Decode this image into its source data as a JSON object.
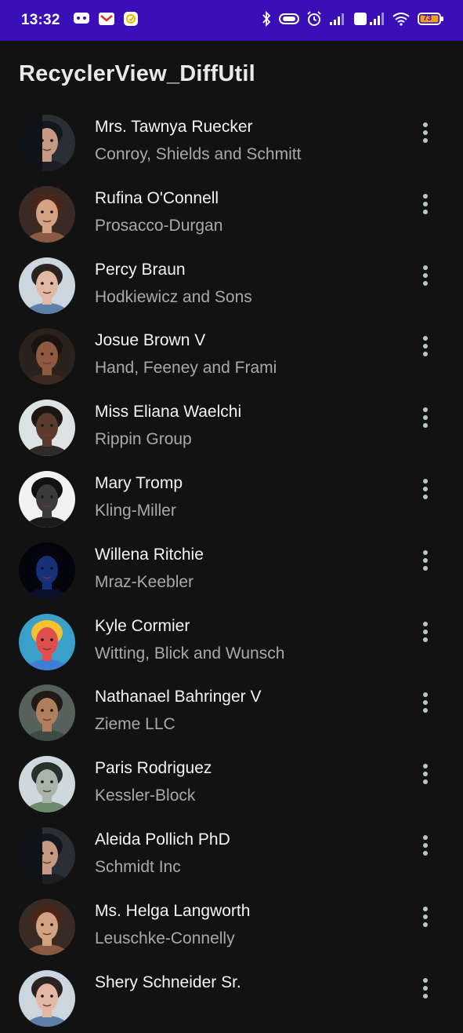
{
  "status_bar": {
    "time": "13:32",
    "battery": "73",
    "background": "#3b0fb8",
    "left_icons": [
      "chat-app-icon",
      "gmail-icon",
      "sync-app-icon"
    ],
    "right_icons": [
      "bluetooth-icon",
      "toggle-icon",
      "alarm-icon",
      "signal-icon",
      "volte-signal-icon",
      "wifi-icon",
      "battery-icon"
    ]
  },
  "app": {
    "title": "RecyclerView_DiffUtil"
  },
  "contacts": [
    {
      "name": "Mrs. Tawnya Ruecker",
      "company": "Conroy, Shields and Schmitt",
      "avatar": "portrait-1"
    },
    {
      "name": "Rufina O'Connell",
      "company": "Prosacco-Durgan",
      "avatar": "portrait-2"
    },
    {
      "name": "Percy Braun",
      "company": "Hodkiewicz and Sons",
      "avatar": "portrait-3"
    },
    {
      "name": "Josue Brown V",
      "company": "Hand, Feeney and Frami",
      "avatar": "portrait-4"
    },
    {
      "name": "Miss Eliana Waelchi",
      "company": "Rippin Group",
      "avatar": "portrait-5"
    },
    {
      "name": "Mary Tromp",
      "company": "Kling-Miller",
      "avatar": "portrait-6"
    },
    {
      "name": "Willena Ritchie",
      "company": "Mraz-Keebler",
      "avatar": "portrait-7"
    },
    {
      "name": "Kyle Cormier",
      "company": "Witting, Blick and Wunsch",
      "avatar": "portrait-8"
    },
    {
      "name": "Nathanael Bahringer V",
      "company": "Zieme LLC",
      "avatar": "portrait-9"
    },
    {
      "name": "Paris Rodriguez",
      "company": "Kessler-Block",
      "avatar": "portrait-10"
    },
    {
      "name": "Aleida Pollich PhD",
      "company": "Schmidt Inc",
      "avatar": "portrait-1"
    },
    {
      "name": "Ms. Helga Langworth",
      "company": "Leuschke-Connelly",
      "avatar": "portrait-2"
    },
    {
      "name": "Shery Schneider Sr.",
      "company": "",
      "avatar": "portrait-3"
    }
  ],
  "more_icon": "more-vert-icon",
  "colors": {
    "background": "#121212",
    "name_text": "#f4f4f4",
    "company_text": "#a9a9a9",
    "more_dots": "#b9c7cc"
  }
}
